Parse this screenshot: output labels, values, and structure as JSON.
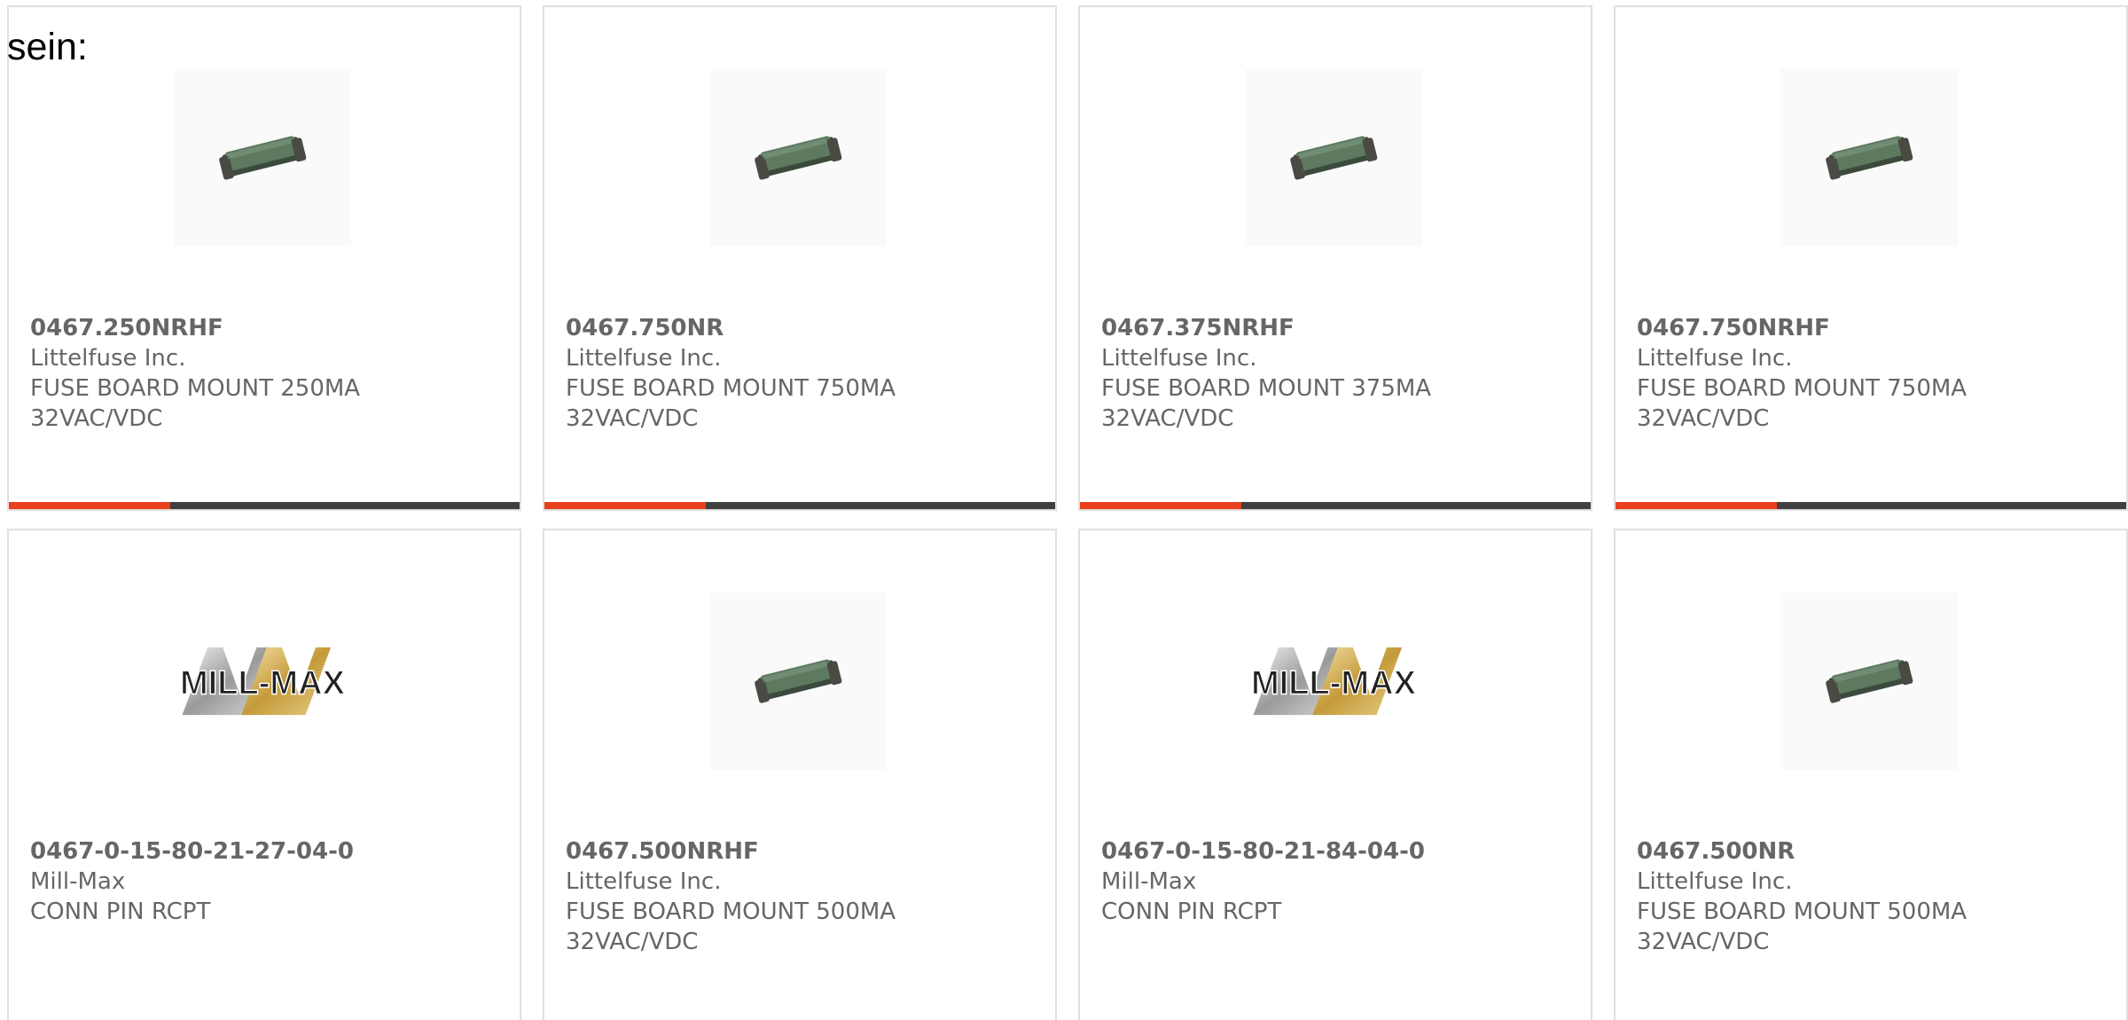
{
  "intro_text": "sein:",
  "colors": {
    "accent": "#e8401c",
    "bar": "#404040",
    "text": "#666666",
    "border": "#e0e0e0"
  },
  "cards": [
    {
      "part_number": "0467.250NRHF",
      "manufacturer": "Littelfuse Inc.",
      "description": "FUSE BOARD MOUNT 250MA\n32VAC/VDC",
      "image": "fuse-icon",
      "has_bar": true
    },
    {
      "part_number": "0467.750NR",
      "manufacturer": "Littelfuse Inc.",
      "description": "FUSE BOARD MOUNT 750MA\n32VAC/VDC",
      "image": "fuse-icon",
      "has_bar": true
    },
    {
      "part_number": "0467.375NRHF",
      "manufacturer": "Littelfuse Inc.",
      "description": "FUSE BOARD MOUNT 375MA\n32VAC/VDC",
      "image": "fuse-icon",
      "has_bar": true
    },
    {
      "part_number": "0467.750NRHF",
      "manufacturer": "Littelfuse Inc.",
      "description": "FUSE BOARD MOUNT 750MA\n32VAC/VDC",
      "image": "fuse-icon",
      "has_bar": true
    },
    {
      "part_number": "0467-0-15-80-21-27-04-0",
      "manufacturer": "Mill-Max",
      "description": "CONN PIN RCPT",
      "image": "mill-max-logo",
      "logo_text": "MILL-MAX",
      "has_bar": false
    },
    {
      "part_number": "0467.500NRHF",
      "manufacturer": "Littelfuse Inc.",
      "description": "FUSE BOARD MOUNT 500MA\n32VAC/VDC",
      "image": "fuse-icon",
      "has_bar": false
    },
    {
      "part_number": "0467-0-15-80-21-84-04-0",
      "manufacturer": "Mill-Max",
      "description": "CONN PIN RCPT",
      "image": "mill-max-logo",
      "logo_text": "MILL-MAX",
      "has_bar": false
    },
    {
      "part_number": "0467.500NR",
      "manufacturer": "Littelfuse Inc.",
      "description": "FUSE BOARD MOUNT 500MA\n32VAC/VDC",
      "image": "fuse-icon",
      "has_bar": false
    }
  ]
}
